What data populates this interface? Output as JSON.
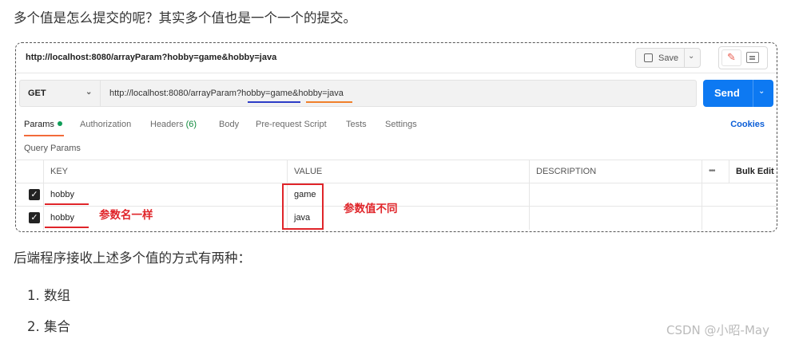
{
  "article": {
    "intro": "多个值是怎么提交的呢？其实多个值也是一个一个的提交。",
    "body_text": "后端程序接收上述多个值的方式有两种：",
    "list": [
      "1. 数组",
      "2. 集合"
    ],
    "watermark": "CSDN @小昭-May"
  },
  "postman": {
    "tab_url": "http://localhost:8080/arrayParam?hobby=game&hobby=java",
    "save_label": "Save",
    "method": "GET",
    "request_url": "http://localhost:8080/arrayParam?hobby=game&hobby=java",
    "send_label": "Send",
    "tabs": {
      "params": "Params",
      "authorization": "Authorization",
      "headers": "Headers",
      "headers_count": "(6)",
      "body": "Body",
      "prerequest": "Pre-request Script",
      "tests": "Tests",
      "settings": "Settings"
    },
    "cookies": "Cookies",
    "query_params_title": "Query Params",
    "table": {
      "headers": {
        "key": "KEY",
        "value": "VALUE",
        "description": "DESCRIPTION",
        "bulk_edit": "Bulk Edit",
        "more": "•••"
      },
      "rows": [
        {
          "key": "hobby",
          "value": "game",
          "checked": true
        },
        {
          "key": "hobby",
          "value": "java",
          "checked": true
        }
      ]
    }
  },
  "annotations": {
    "same_name": "参数名一样",
    "different_value": "参数值不同",
    "color": "#e0252a"
  },
  "colors": {
    "send_button": "#0d79f2",
    "active_tab_underline": "#f26b3a",
    "underline_blue": "#2d3cc7",
    "underline_orange": "#f07f2a"
  }
}
